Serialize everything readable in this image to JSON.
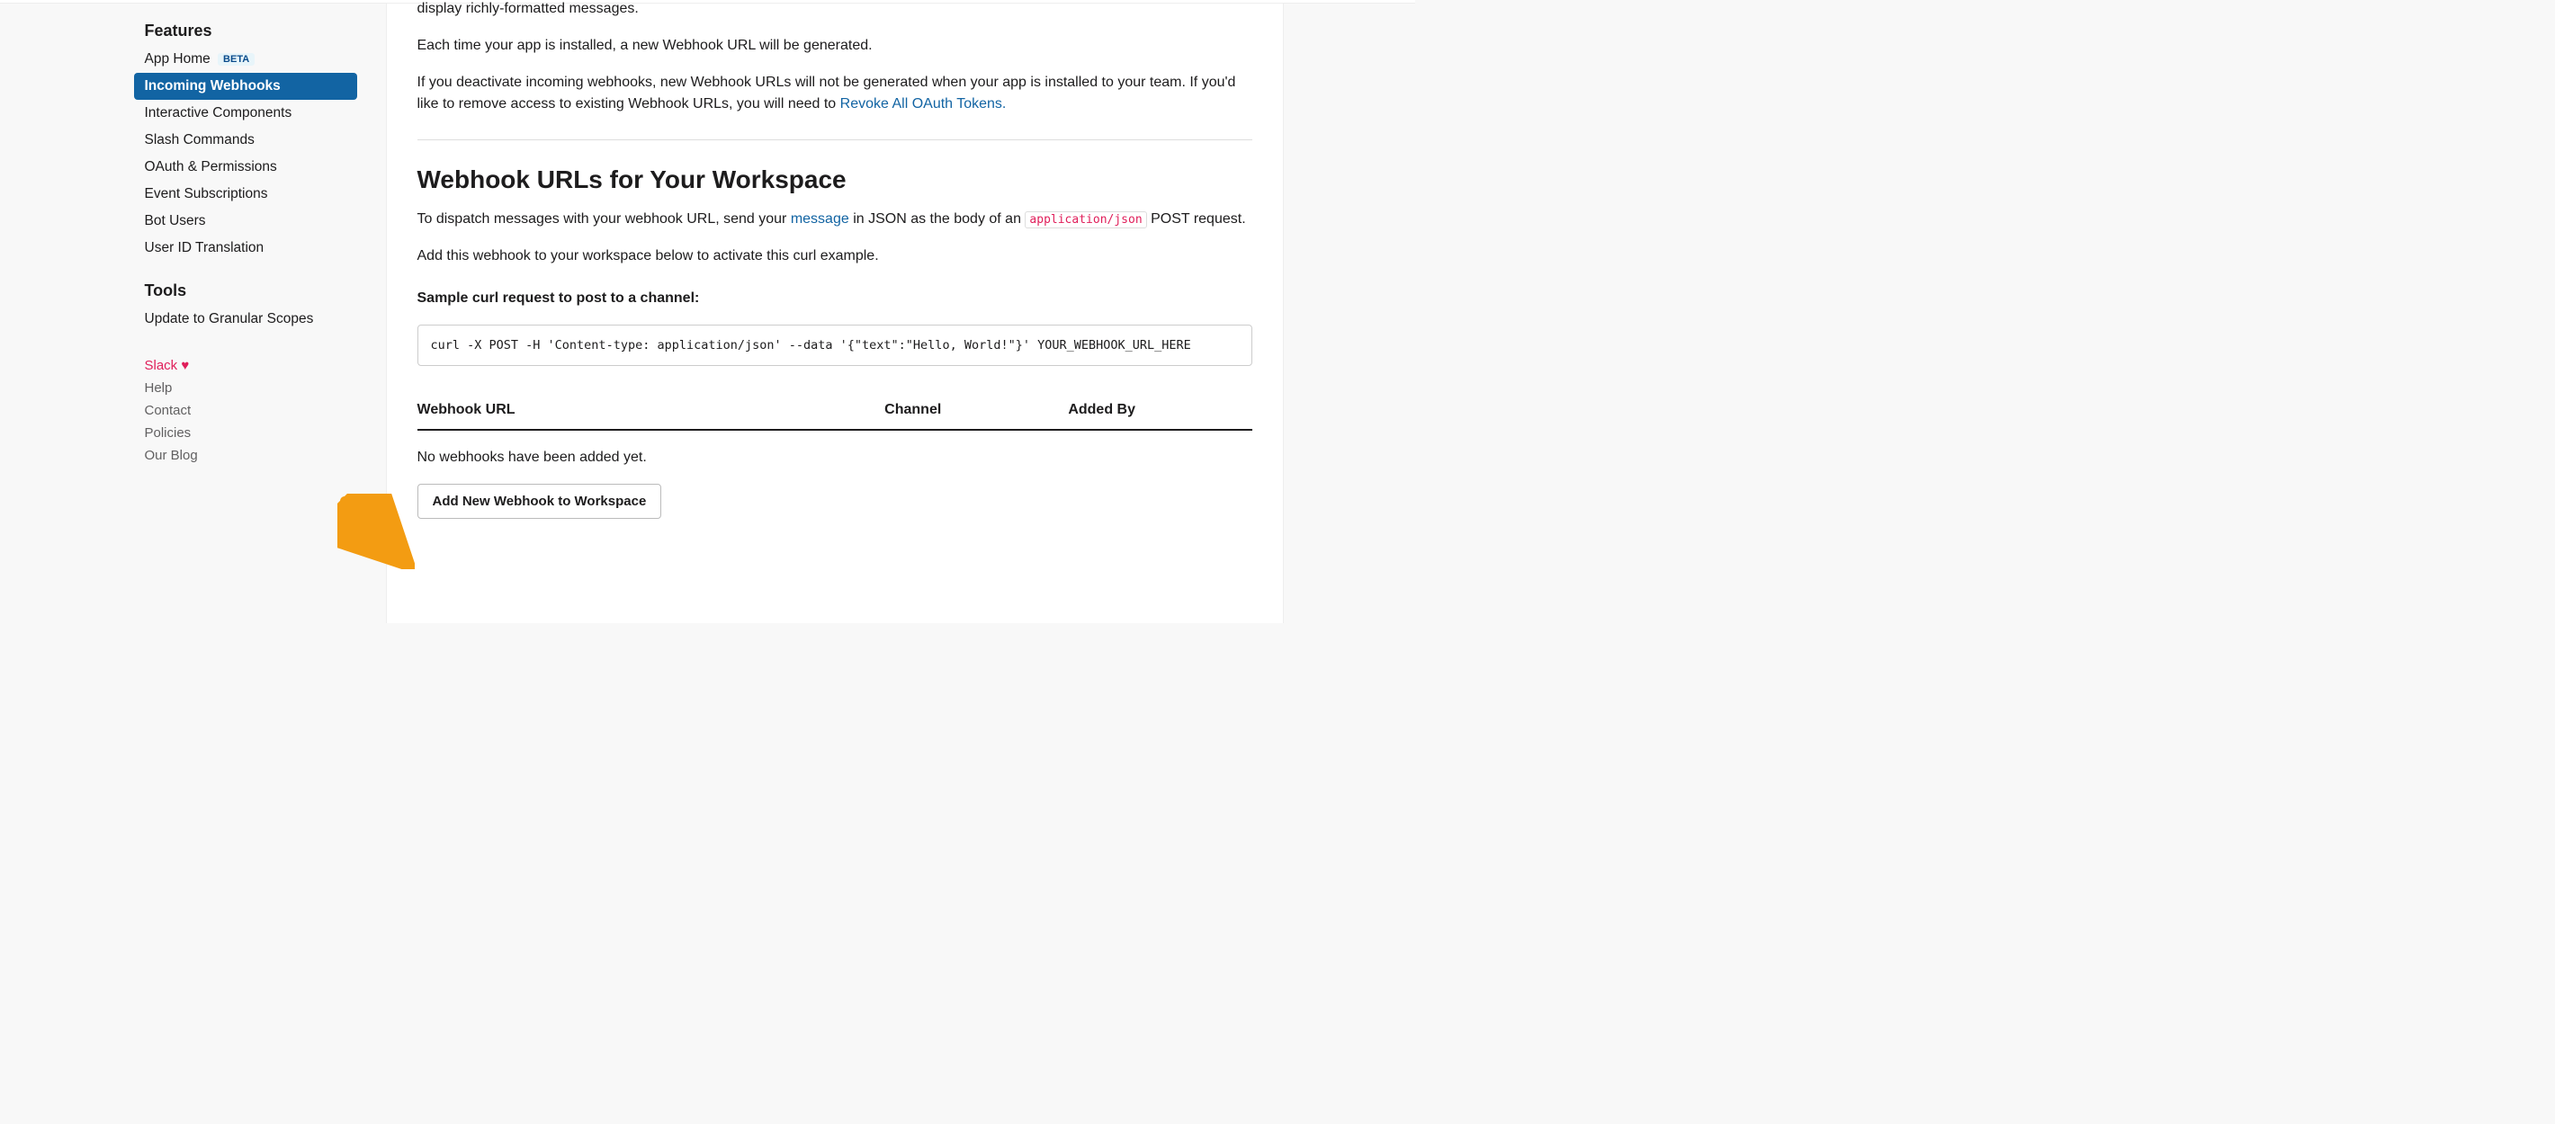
{
  "sidebar": {
    "features_title": "Features",
    "items": [
      {
        "label": "App Home",
        "badge": "BETA"
      },
      {
        "label": "Incoming Webhooks"
      },
      {
        "label": "Interactive Components"
      },
      {
        "label": "Slash Commands"
      },
      {
        "label": "OAuth & Permissions"
      },
      {
        "label": "Event Subscriptions"
      },
      {
        "label": "Bot Users"
      },
      {
        "label": "User ID Translation"
      }
    ],
    "tools_title": "Tools",
    "tools": [
      {
        "label": "Update to Granular Scopes"
      }
    ],
    "footer": {
      "slack": "Slack",
      "help": "Help",
      "contact": "Contact",
      "policies": "Policies",
      "blog": "Our Blog"
    }
  },
  "content": {
    "cut_line": "display richly-formatted messages.",
    "p1": "Each time your app is installed, a new Webhook URL will be generated.",
    "p2a": "If you deactivate incoming webhooks, new Webhook URLs will not be generated when your app is installed to your team. If you'd like to remove access to existing Webhook URLs, you will need to ",
    "p2_link": "Revoke All OAuth Tokens.",
    "section_title": "Webhook URLs for Your Workspace",
    "p3a": "To dispatch messages with your webhook URL, send your ",
    "p3_link": "message",
    "p3b": " in JSON as the body of an ",
    "p3_code": "application/json",
    "p3c": " POST request.",
    "p4": "Add this webhook to your workspace below to activate this curl example.",
    "sample_label": "Sample curl request to post to a channel:",
    "code": "curl -X POST -H 'Content-type: application/json' --data '{\"text\":\"Hello, World!\"}' YOUR_WEBHOOK_URL_HERE",
    "table": {
      "col_url": "Webhook URL",
      "col_channel": "Channel",
      "col_added_by": "Added By"
    },
    "empty": "No webhooks have been added yet.",
    "add_button": "Add New Webhook to Workspace"
  }
}
